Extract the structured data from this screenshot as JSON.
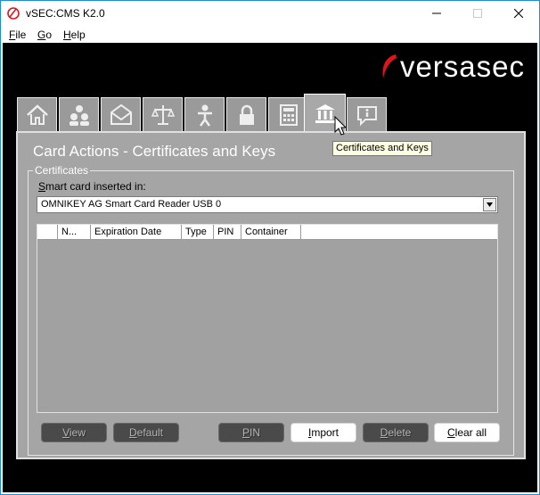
{
  "window": {
    "title": "vSEC:CMS K2.0",
    "minimize_icon": "minimize-icon",
    "maximize_icon": "maximize-icon",
    "close_icon": "close-icon"
  },
  "menu": [
    "File",
    "Go",
    "Help"
  ],
  "brand": {
    "logo_text": "versasec",
    "accent_color": "#e0141e"
  },
  "tabs": [
    {
      "icon": "home-icon"
    },
    {
      "icon": "users-icon"
    },
    {
      "icon": "mail-icon"
    },
    {
      "icon": "scales-icon"
    },
    {
      "icon": "person-icon"
    },
    {
      "icon": "lock-icon"
    },
    {
      "icon": "calculator-icon"
    },
    {
      "icon": "bank-icon",
      "active": true
    },
    {
      "icon": "info-bubble-icon"
    }
  ],
  "tooltip": "Certificates and Keys",
  "panel": {
    "title": "Card Actions - Certificates and Keys",
    "group_label": "Certificates",
    "reader_label": "Smart card inserted in:",
    "reader_value": "OMNIKEY AG Smart Card Reader USB 0",
    "columns": [
      "",
      "N...",
      "Expiration Date",
      "Type",
      "PIN",
      "Container"
    ],
    "rows": []
  },
  "buttons": {
    "view": "View",
    "default": "Default",
    "pin": "PIN",
    "import": "Import",
    "delete": "Delete",
    "clear_all": "Clear all"
  }
}
